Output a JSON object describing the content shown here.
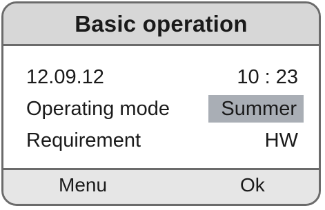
{
  "header": {
    "title": "Basic operation"
  },
  "status": {
    "date": "12.09.12",
    "time": "10 : 23"
  },
  "rows": [
    {
      "label": "Operating mode",
      "value": "Summer",
      "selected": true
    },
    {
      "label": "Requirement",
      "value": "HW",
      "selected": false
    }
  ],
  "softkeys": {
    "left": "Menu",
    "right": "Ok"
  },
  "colors": {
    "frame": "#6b6b6b",
    "title_bg": "#d7d7d7",
    "content_bg": "#ffffff",
    "selection": "#a9aeb5"
  }
}
